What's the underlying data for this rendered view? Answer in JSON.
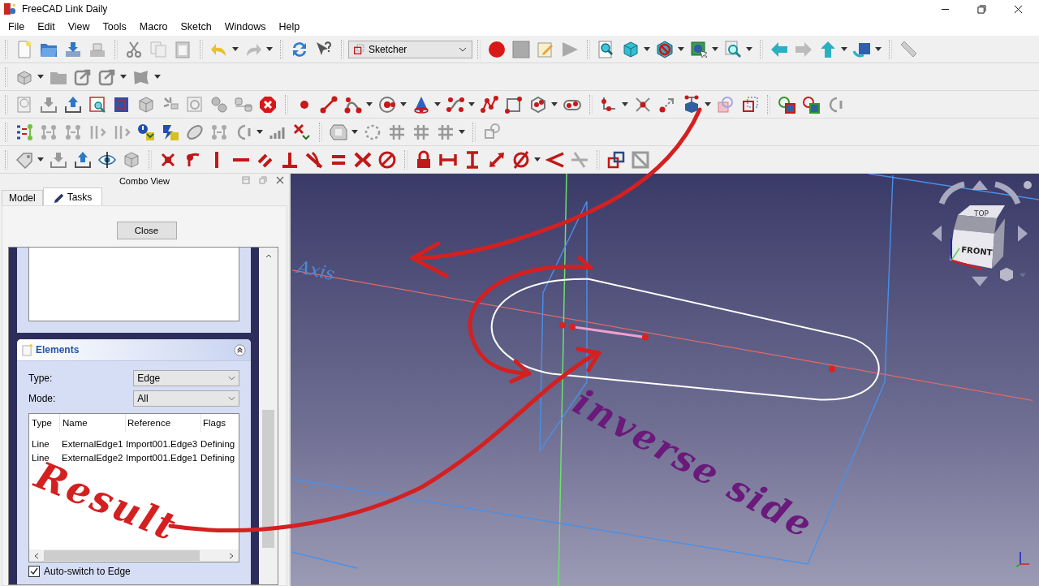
{
  "window": {
    "title": "FreeCAD Link Daily"
  },
  "menu": [
    "File",
    "Edit",
    "View",
    "Tools",
    "Macro",
    "Sketch",
    "Windows",
    "Help"
  ],
  "workbench": "Sketcher",
  "combo_view": {
    "title": "Combo View",
    "close_button": "Close",
    "tabs": [
      {
        "label": "Model",
        "selected": false
      },
      {
        "label": "Tasks",
        "selected": true
      }
    ]
  },
  "elements_panel": {
    "title": "Elements",
    "expanded": true,
    "type": {
      "label": "Type:",
      "value": "Edge"
    },
    "mode": {
      "label": "Mode:",
      "value": "All"
    },
    "columns": [
      "Type",
      "Name",
      "Reference",
      "Flags"
    ],
    "rows": [
      [
        "Line",
        "ExternalEdge1",
        "Import001.Edge3",
        "Defining"
      ],
      [
        "Line",
        "ExternalEdge2",
        "Import001.Edge1",
        "Defining"
      ]
    ],
    "auto_switch": {
      "label": "Auto-switch to Edge",
      "checked": true
    }
  },
  "viewport": {
    "axis_label": "Axis",
    "nav_cube": {
      "top": "TOP",
      "front": "FRONT"
    }
  },
  "annotations": [
    {
      "text": "Result",
      "color": "#d42020"
    },
    {
      "text": "inverse side",
      "color": "#6a1a7a"
    }
  ]
}
